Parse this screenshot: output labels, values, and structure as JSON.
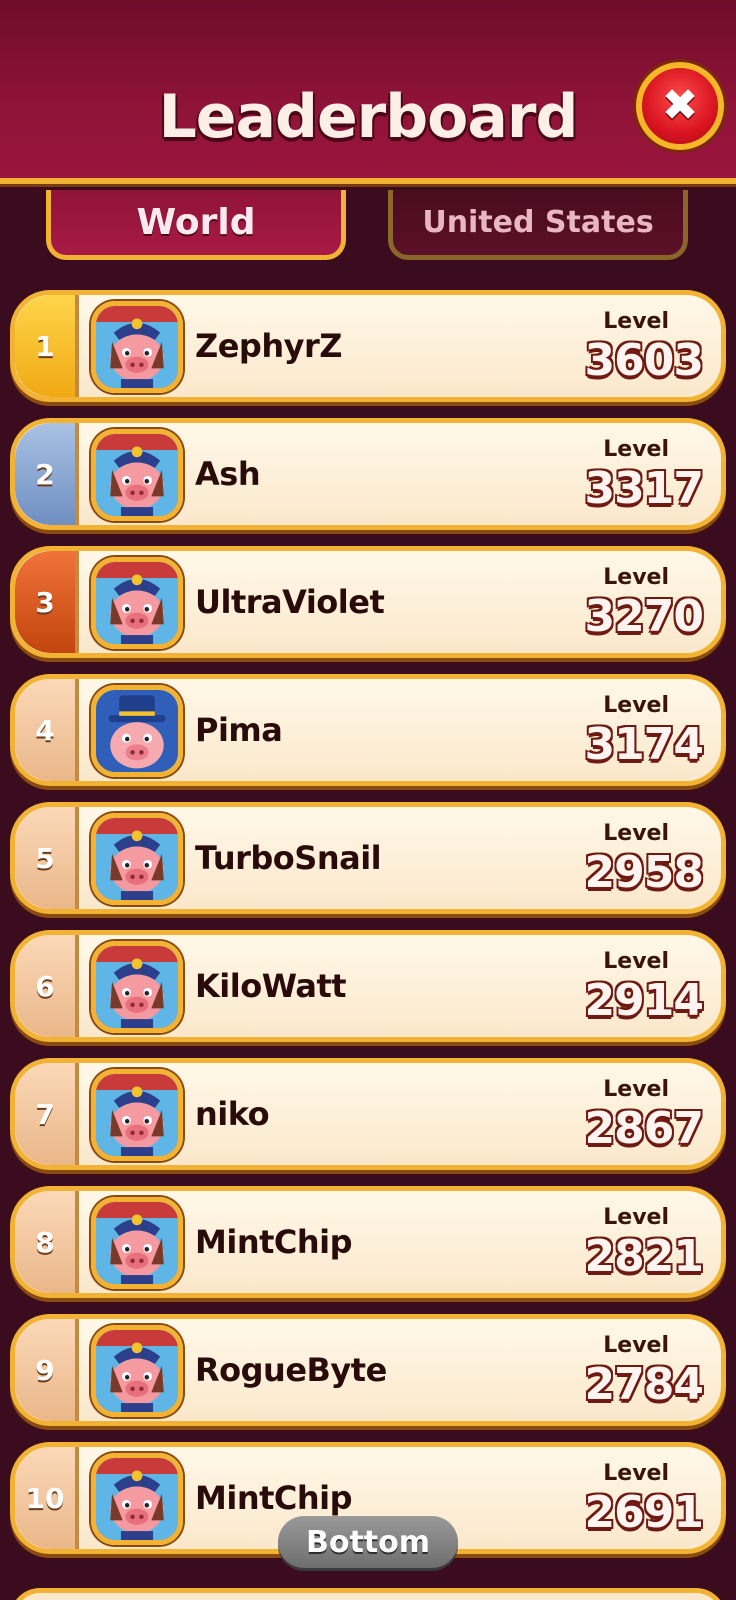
{
  "header": {
    "title": "Leaderboard"
  },
  "tabs": [
    {
      "label": "World",
      "active": true
    },
    {
      "label": "United States",
      "active": false
    }
  ],
  "level_label": "Level",
  "players": [
    {
      "rank": "1",
      "name": "ZephyrZ",
      "level": "3603",
      "medal": "gold",
      "avatar": "pig-captain-avatar"
    },
    {
      "rank": "2",
      "name": "Ash",
      "level": "3317",
      "medal": "silver",
      "avatar": "pig-captain-avatar"
    },
    {
      "rank": "3",
      "name": "UltraViolet",
      "level": "3270",
      "medal": "bronze",
      "avatar": "pig-captain-avatar"
    },
    {
      "rank": "4",
      "name": "Pima",
      "level": "3174",
      "medal": "plain",
      "avatar": "pig-top-hat-avatar"
    },
    {
      "rank": "5",
      "name": "TurboSnail",
      "level": "2958",
      "medal": "plain",
      "avatar": "pig-captain-avatar"
    },
    {
      "rank": "6",
      "name": "KiloWatt",
      "level": "2914",
      "medal": "plain",
      "avatar": "pig-captain-avatar"
    },
    {
      "rank": "7",
      "name": "niko",
      "level": "2867",
      "medal": "plain",
      "avatar": "pig-captain-avatar"
    },
    {
      "rank": "8",
      "name": "MintChip",
      "level": "2821",
      "medal": "plain",
      "avatar": "pig-captain-avatar"
    },
    {
      "rank": "9",
      "name": "RogueByte",
      "level": "2784",
      "medal": "plain",
      "avatar": "pig-captain-avatar"
    },
    {
      "rank": "10",
      "name": "MintChip",
      "level": "2691",
      "medal": "plain",
      "avatar": "pig-captain-avatar"
    }
  ],
  "bottom_button": {
    "label": "Bottom"
  },
  "colors": {
    "background": "#3a0c1d",
    "header": "#8f1338",
    "gold_border": "#f2b233",
    "row_fill": "#fff4dc"
  }
}
